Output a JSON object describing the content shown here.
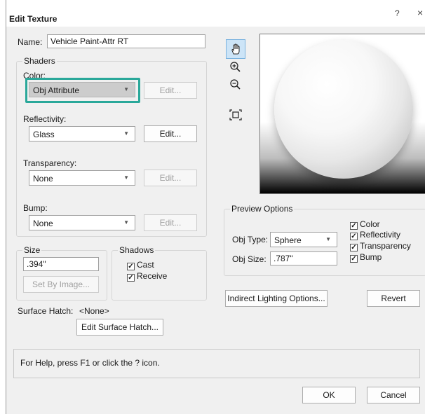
{
  "window": {
    "title": "Edit Texture",
    "help_glyph": "?",
    "close_glyph": "×"
  },
  "name": {
    "label": "Name:",
    "value": "Vehicle Paint-Attr RT"
  },
  "shaders": {
    "title": "Shaders",
    "color": {
      "label": "Color:",
      "value": "Obj Attribute",
      "edit": "Edit..."
    },
    "reflectivity": {
      "label": "Reflectivity:",
      "value": "Glass",
      "edit": "Edit..."
    },
    "transparency": {
      "label": "Transparency:",
      "value": "None",
      "edit": "Edit..."
    },
    "bump": {
      "label": "Bump:",
      "value": "None",
      "edit": "Edit..."
    }
  },
  "size": {
    "title": "Size",
    "value": ".394\"",
    "set_by_image": "Set By Image..."
  },
  "shadows": {
    "title": "Shadows",
    "cast": "Cast",
    "receive": "Receive"
  },
  "surface_hatch": {
    "label": "Surface Hatch:",
    "value": "<None>",
    "edit": "Edit Surface Hatch..."
  },
  "tools": {
    "pan": "hand-icon",
    "zoom_in": "zoom-in-icon",
    "zoom_out": "zoom-out-icon",
    "fit": "fit-view-icon"
  },
  "preview_options": {
    "title": "Preview Options",
    "obj_type_label": "Obj Type:",
    "obj_type_value": "Sphere",
    "obj_size_label": "Obj Size:",
    "obj_size_value": ".787\"",
    "checks": [
      "Color",
      "Reflectivity",
      "Transparency",
      "Bump"
    ]
  },
  "buttons": {
    "indirect_lighting": "Indirect Lighting Options...",
    "revert": "Revert",
    "ok": "OK",
    "cancel": "Cancel"
  },
  "status": "For Help, press F1 or click the ? icon.",
  "colors": {
    "highlight": "#2aa89a",
    "active_tool": "#cce4f7"
  }
}
